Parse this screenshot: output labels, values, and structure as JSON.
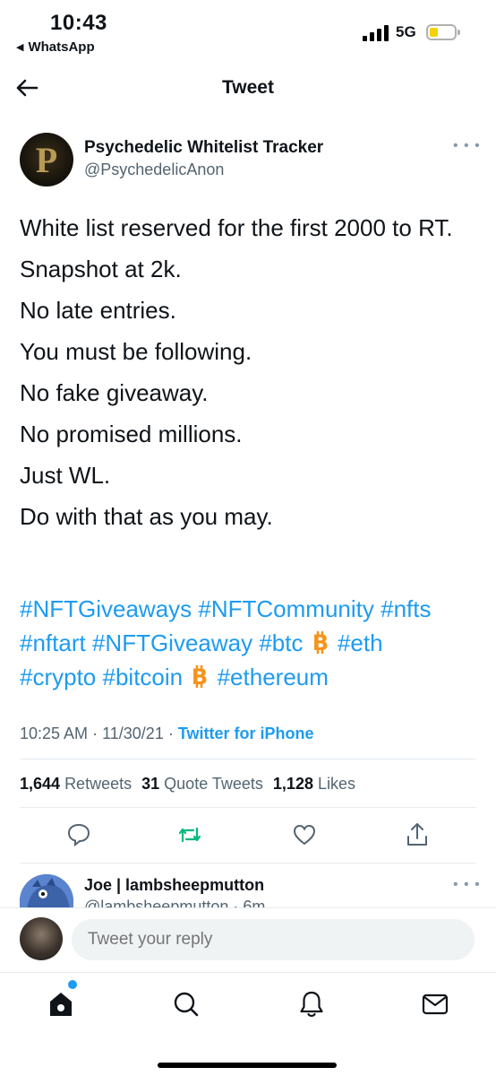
{
  "status_bar": {
    "time": "10:43",
    "back_app": "WhatsApp",
    "network": "5G",
    "back_triangle": "◀"
  },
  "header": {
    "title": "Tweet"
  },
  "tweet": {
    "author_name": "Psychedelic Whitelist Tracker",
    "author_handle": "@PsychedelicAnon",
    "avatar_letter": "P",
    "lines": [
      "White list reserved for the first 2000 to RT.",
      "Snapshot at 2k.",
      "No late entries.",
      "You must be following.",
      "No fake giveaway.",
      "No promised millions.",
      "Just WL.",
      "Do with that as you may."
    ],
    "hashtags": {
      "h1": "#NFTGiveaways",
      "h2": "#NFTCommunity",
      "h3": "#nfts",
      "h4": "#nftart",
      "h5": "#NFTGiveaway",
      "h6": "#btc",
      "h7": "#eth",
      "h8": "#crypto",
      "h9": "#bitcoin",
      "h10": "#ethereum"
    },
    "time": "10:25 AM",
    "date": "11/30/21",
    "separator": "·",
    "source": "Twitter for iPhone",
    "stats": {
      "retweets_count": "1,644",
      "retweets_label": "Retweets",
      "quotes_count": "31",
      "quotes_label": "Quote Tweets",
      "likes_count": "1,128",
      "likes_label": "Likes"
    }
  },
  "reply_preview": {
    "name": "Joe | lambsheepmutton",
    "handle": "@lambsheepmutton · 6m"
  },
  "compose": {
    "placeholder": "Tweet your reply"
  },
  "colors": {
    "accent": "#1d9bf0",
    "retweet": "#00ba7c",
    "bitcoin": "#f7931a",
    "text": "#0f1419",
    "secondary": "#536471"
  },
  "icons": {
    "more": "more-icon",
    "reply": "reply-icon",
    "retweet": "retweet-icon",
    "like": "heart-icon",
    "share": "share-icon",
    "home": "home-icon",
    "search": "search-icon",
    "notifications": "bell-icon",
    "messages": "mail-icon",
    "bitcoin": "bitcoin-emoji-icon"
  }
}
